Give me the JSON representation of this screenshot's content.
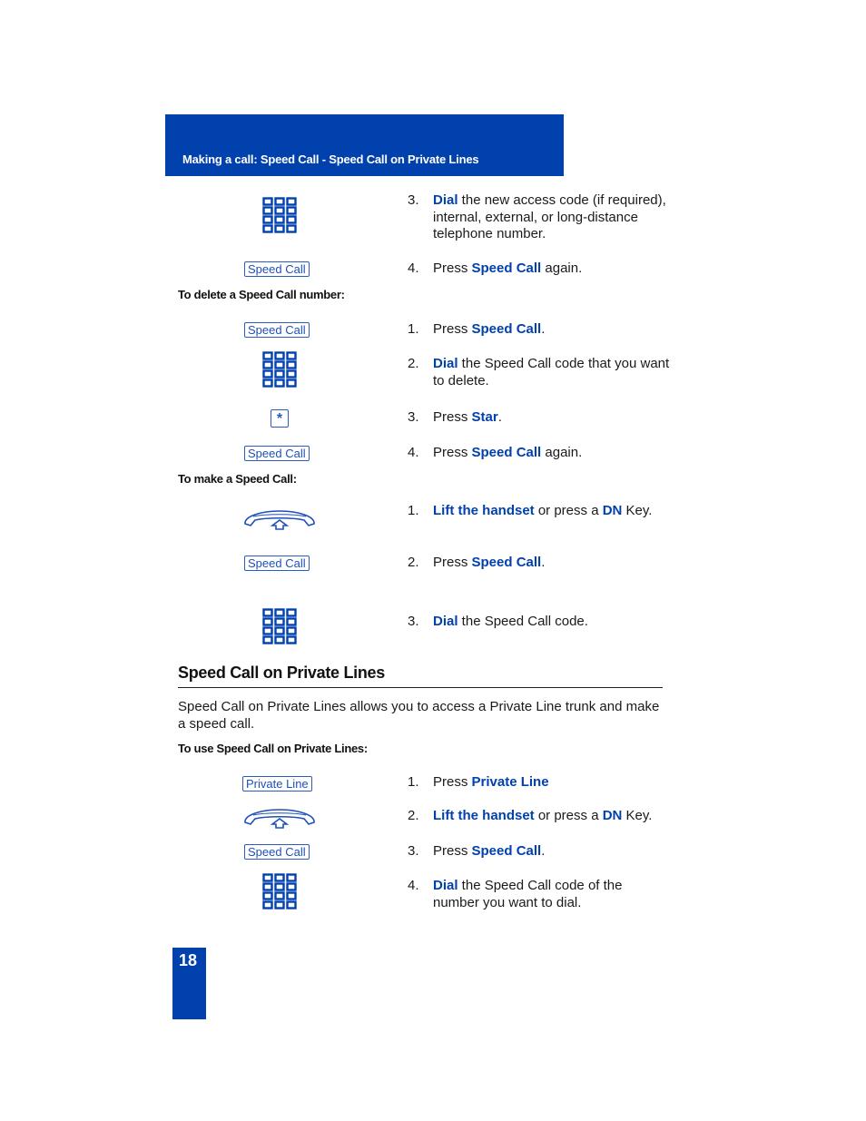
{
  "header": {
    "title": "Making a call: Speed Call - Speed Call on Private Lines"
  },
  "colors": {
    "brand_blue": "#0041ad",
    "key_blue": "#2a5cc0"
  },
  "page_number": "18",
  "top_steps": [
    {
      "num": "3.",
      "icon": "keypad-icon",
      "kw": "Dial",
      "rest": " the new access code (if required), internal, external, or long-distance telephone number."
    },
    {
      "num": "4.",
      "icon": "speed-call-key",
      "softkey": "Speed Call",
      "pre": "Press ",
      "kw": "Speed Call",
      "rest": " again."
    }
  ],
  "delete_section": {
    "heading": "To delete a Speed Call number:",
    "steps": [
      {
        "num": "1.",
        "softkey": "Speed Call",
        "pre": "Press ",
        "kw": "Speed Call",
        "rest": "."
      },
      {
        "num": "2.",
        "kw": "Dial",
        "rest": " the Speed Call code that you want to delete."
      },
      {
        "num": "3.",
        "star": "*",
        "pre": "Press ",
        "kw": "Star",
        "rest": "."
      },
      {
        "num": "4.",
        "softkey": "Speed Call",
        "pre": "Press ",
        "kw": "Speed Call",
        "rest": " again."
      }
    ]
  },
  "make_section": {
    "heading": "To make a Speed Call:",
    "steps": [
      {
        "num": "1.",
        "kw": "Lift the handset",
        "mid": " or press a ",
        "kw2": "DN",
        "rest": " Key."
      },
      {
        "num": "2.",
        "softkey": "Speed Call",
        "pre": "Press ",
        "kw": "Speed Call",
        "rest": "."
      },
      {
        "num": "3.",
        "kw": "Dial",
        "rest": " the Speed Call code."
      }
    ]
  },
  "private_lines": {
    "title": "Speed Call on Private Lines",
    "body": "Speed Call on Private Lines allows you to access a Private Line trunk and make a speed call.",
    "heading": "To use Speed Call on Private Lines:",
    "steps": [
      {
        "num": "1.",
        "softkey": "Private Line",
        "pre": "Press ",
        "kw": "Private Line",
        "rest": ""
      },
      {
        "num": "2.",
        "kw": "Lift the handset",
        "mid": " or press a ",
        "kw2": "DN",
        "rest": " Key."
      },
      {
        "num": "3.",
        "softkey": "Speed Call",
        "pre": "Press ",
        "kw": "Speed Call",
        "rest": "."
      },
      {
        "num": "4.",
        "kw": "Dial",
        "rest": " the Speed Call code of the number you want to dial."
      }
    ]
  }
}
